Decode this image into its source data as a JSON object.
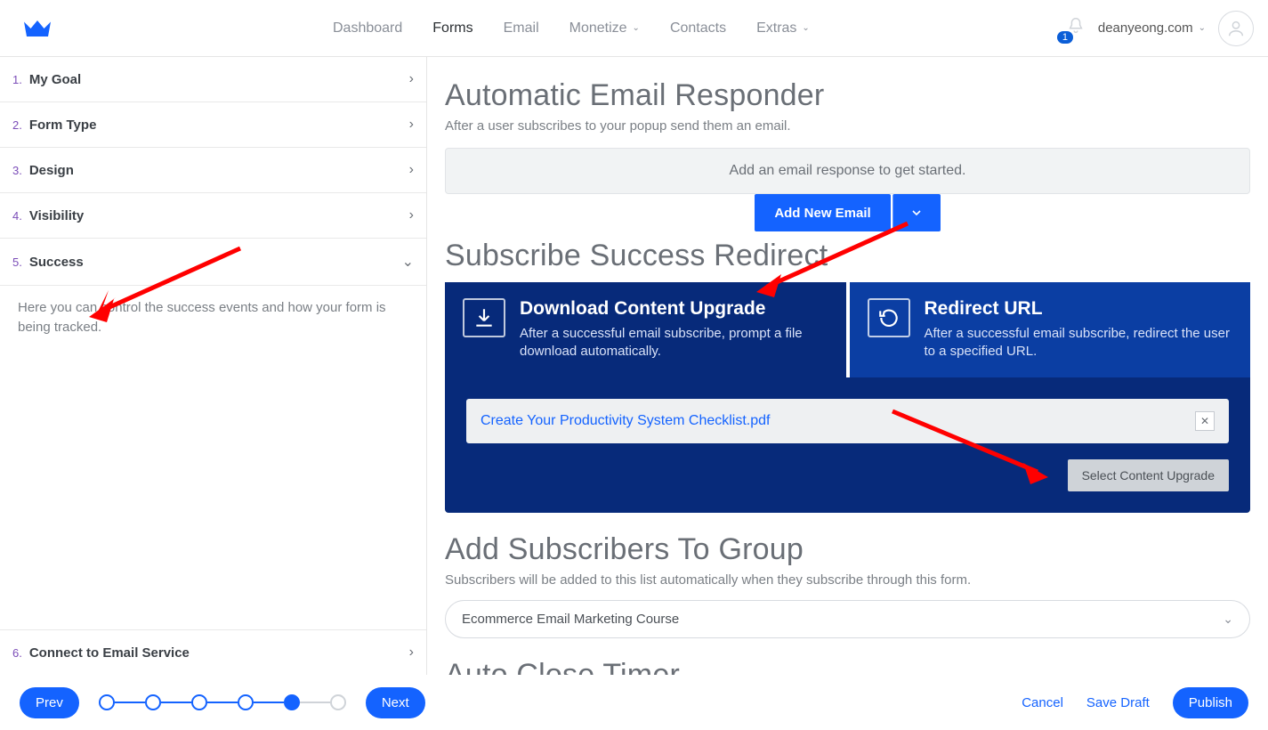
{
  "nav": {
    "items": [
      "Dashboard",
      "Forms",
      "Email",
      "Monetize",
      "Contacts",
      "Extras"
    ],
    "active": "Forms",
    "badge": "1",
    "account": "deanyeong.com"
  },
  "sidebar": {
    "steps": [
      {
        "num": "1.",
        "label": "My Goal"
      },
      {
        "num": "2.",
        "label": "Form Type"
      },
      {
        "num": "3.",
        "label": "Design"
      },
      {
        "num": "4.",
        "label": "Visibility"
      },
      {
        "num": "5.",
        "label": "Success"
      },
      {
        "num": "6.",
        "label": "Connect to Email Service"
      }
    ],
    "desc": "Here you can control the success events and how your form is being tracked."
  },
  "responder": {
    "title": "Automatic Email Responder",
    "sub": "After a user subscribes to your popup send them an email.",
    "notice": "Add an email response to get started.",
    "add_btn": "Add New Email"
  },
  "redirect": {
    "title": "Subscribe Success Redirect",
    "download": {
      "title": "Download Content Upgrade",
      "desc": "After a successful email subscribe, prompt a file download automatically."
    },
    "url": {
      "title": "Redirect URL",
      "desc": "After a successful email subscribe, redirect the user to a specified URL."
    },
    "file": "Create Your Productivity System Checklist.pdf",
    "select_btn": "Select Content Upgrade"
  },
  "group": {
    "title": "Add Subscribers To Group",
    "sub": "Subscribers will be added to this list automatically when they subscribe through this form.",
    "value": "Ecommerce Email Marketing Course"
  },
  "timer": {
    "title": "Auto Close Timer"
  },
  "footer": {
    "prev": "Prev",
    "next": "Next",
    "cancel": "Cancel",
    "save": "Save Draft",
    "publish": "Publish"
  }
}
